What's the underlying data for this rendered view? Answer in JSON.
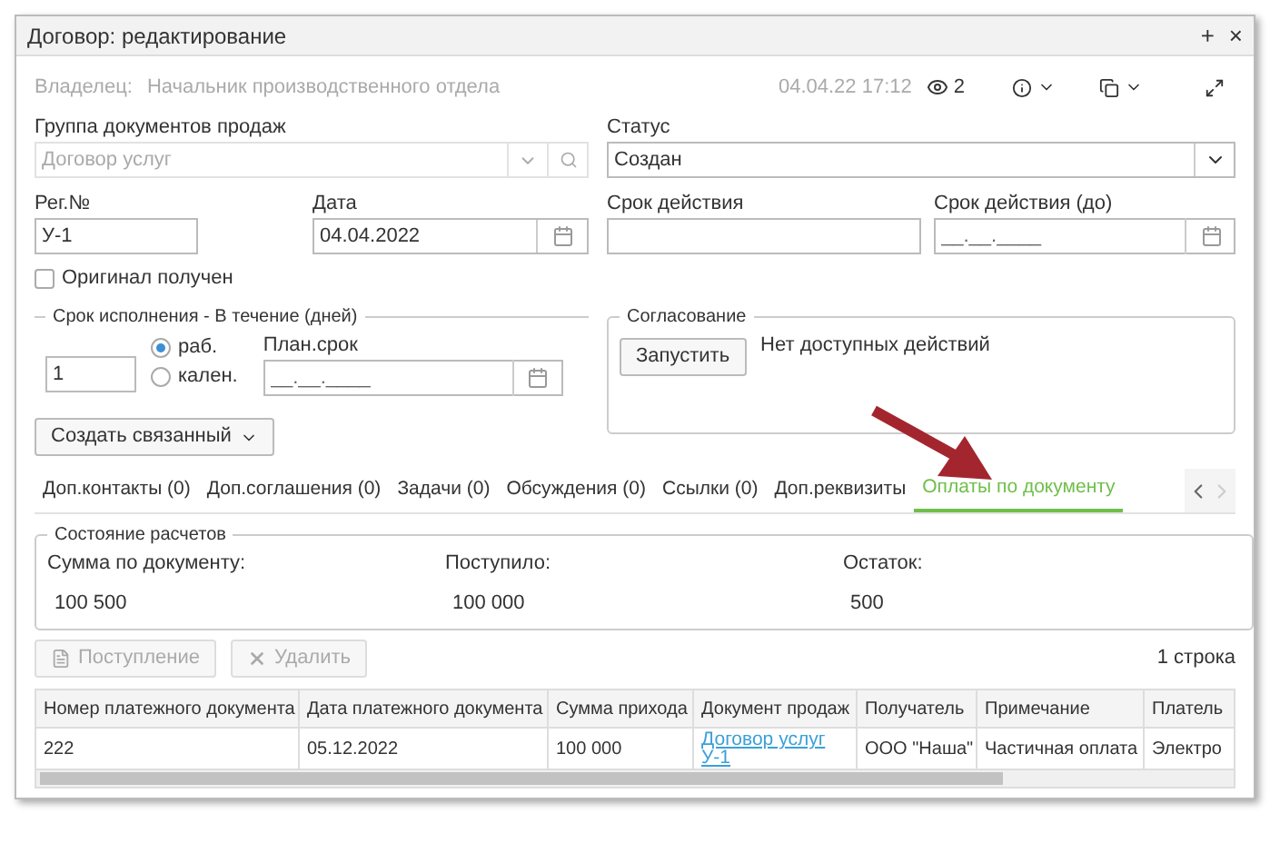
{
  "window": {
    "title": "Договор: редактирование",
    "controls": [
      "+",
      "×"
    ]
  },
  "header": {
    "owner_label": "Владелец:",
    "owner": "Начальник производственного отдела",
    "timestamp": "04.04.22 17:12",
    "views": "2"
  },
  "group": {
    "label": "Группа документов продаж",
    "value": "Договор услуг",
    "disabled": true
  },
  "status": {
    "label": "Статус",
    "value": "Создан"
  },
  "reg": {
    "label": "Рег.№",
    "value": "У-1"
  },
  "date": {
    "label": "Дата",
    "value": "04.04.2022"
  },
  "term": {
    "label": "Срок действия"
  },
  "term_to": {
    "label": "Срок действия (до)",
    "placeholder": "__.__.____"
  },
  "original": {
    "label": "Оригинал получен",
    "checked": false
  },
  "deadline": {
    "legend": "Срок исполнения - В течение (дней)",
    "days": "1",
    "radios": [
      {
        "label": "раб.",
        "selected": true
      },
      {
        "label": "кален.",
        "selected": false
      }
    ],
    "plan_label": "План.срок",
    "plan_placeholder": "__.__.____"
  },
  "approval": {
    "legend": "Согласование",
    "button": "Запустить",
    "message": "Нет доступных действий"
  },
  "create_button": "Создать связанный",
  "tabs": [
    {
      "label": "Доп.контакты (0)",
      "selected": false
    },
    {
      "label": "Доп.соглашения (0)",
      "selected": false
    },
    {
      "label": "Задачи (0)",
      "selected": false
    },
    {
      "label": "Обсуждения (0)",
      "selected": false
    },
    {
      "label": "Ссылки (0)",
      "selected": false
    },
    {
      "label": "Доп.реквизиты",
      "selected": false
    },
    {
      "label": "Оплаты по документу",
      "selected": true
    }
  ],
  "settlement": {
    "legend": "Состояние расчетов",
    "items": [
      {
        "label": "Сумма по документу:",
        "value": "100 500"
      },
      {
        "label": "Поступило:",
        "value": "100 000"
      },
      {
        "label": "Остаток:",
        "value": "500"
      }
    ]
  },
  "toolbar": {
    "buttons": [
      {
        "label": "Поступление",
        "kind": "add",
        "disabled": true
      },
      {
        "label": "Удалить",
        "kind": "delete",
        "disabled": true
      }
    ],
    "count": "1 строка"
  },
  "table": {
    "columns": [
      "Номер платежного документа",
      "Дата платежного документа",
      "Сумма прихода",
      "Документ продаж",
      "Получатель",
      "Примечание",
      "Платель"
    ],
    "rows": [
      {
        "cells": [
          {
            "text": "222",
            "kind": "text"
          },
          {
            "text": "05.12.2022",
            "kind": "text"
          },
          {
            "text": "100 000",
            "kind": "text"
          },
          {
            "text": "Договор услуг У-1",
            "kind": "link"
          },
          {
            "text": "ООО \"Наша\"",
            "kind": "text"
          },
          {
            "text": "Частичная оплата",
            "kind": "text"
          },
          {
            "text": "Электро",
            "kind": "text"
          }
        ]
      }
    ]
  }
}
